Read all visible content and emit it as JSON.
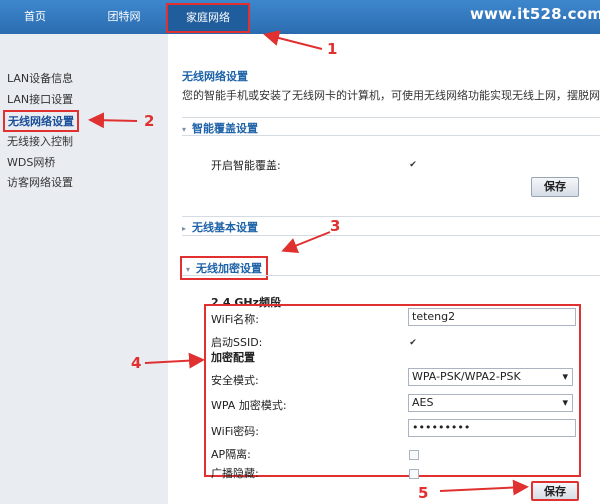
{
  "topbar": {
    "tabs": [
      "首页",
      "团特网",
      "家庭网络"
    ],
    "watermark": "www.it528.com"
  },
  "sidebar": {
    "items": [
      "LAN设备信息",
      "LAN接口设置",
      "无线网络设置",
      "无线接入控制",
      "WDS网桥",
      "访客网络设置"
    ]
  },
  "main": {
    "title": "无线网络设置",
    "intro": "您的智能手机或安装了无线网卡的计算机，可使用无线网络功能实现无线上网，摆脱网线的",
    "smart": {
      "head": "智能覆盖设置",
      "enable_label": "开启智能覆盖:",
      "save": "保存"
    },
    "basic_head": "无线基本设置",
    "enc": {
      "head": "无线加密设置",
      "freq": "2.4 GHz频段",
      "wifi_name_label": "WiFi名称:",
      "wifi_name_value": "teteng2",
      "ssid_label": "启动SSID:",
      "enc_cfg_label": "加密配置",
      "sec_mode_label": "安全模式:",
      "sec_mode_value": "WPA-PSK/WPA2-PSK",
      "wpa_mode_label": "WPA 加密模式:",
      "wpa_mode_value": "AES",
      "pwd_label": "WiFi密码:",
      "pwd_value": "•••••••••",
      "ap_label": "AP隔离:",
      "broadcast_label": "广播隐藏:",
      "save": "保存"
    }
  },
  "annotations": [
    "1",
    "2",
    "3",
    "4",
    "5"
  ],
  "colors": {
    "topbar": "#2b6cb0",
    "highlight": "#e03030",
    "section": "#1f63a8"
  }
}
